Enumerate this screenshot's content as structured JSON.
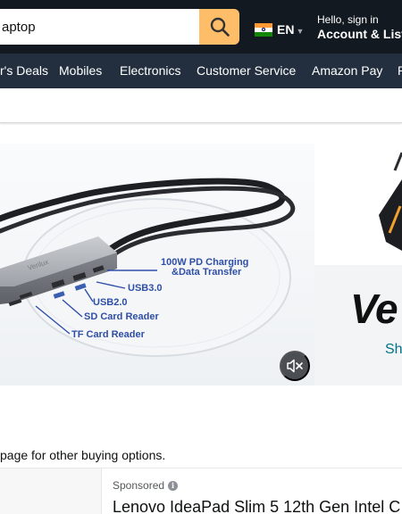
{
  "header": {
    "search_value": "aptop",
    "language_code": "EN",
    "account_greeting": "Hello, sign in",
    "account_label": "Account & Lists"
  },
  "subnav": {
    "items": [
      {
        "label": "r's Deals"
      },
      {
        "label": "Mobiles"
      },
      {
        "label": "Electronics"
      },
      {
        "label": "Customer Service"
      },
      {
        "label": "Amazon Pay"
      },
      {
        "label": "P"
      }
    ]
  },
  "hero": {
    "product_brand_text": "Verilux",
    "callouts": [
      "100W PD Charging",
      "&Data Transfer",
      "USB3.0",
      "USB2.0",
      "SD Card Reader",
      "TF Card Reader"
    ],
    "mute_icon": "speaker-muted-icon"
  },
  "side_ad": {
    "brand": "Ve",
    "cta": "Sh"
  },
  "main": {
    "buying_options_text": "page for other buying options.",
    "sponsored_label": "Sponsored",
    "product_title": "Lenovo IdeaPad Slim 5 12th Gen Intel C"
  },
  "colors": {
    "nav_dark": "#131921",
    "subnav": "#232f3e",
    "search_button": "#febd69",
    "link": "#007185",
    "callout_text": "#2f4fa8"
  }
}
